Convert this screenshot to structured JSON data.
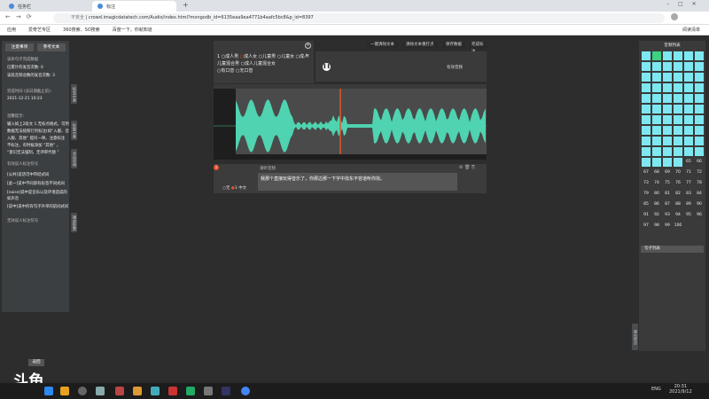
{
  "browser": {
    "tabs": [
      {
        "label": "任务栏"
      },
      {
        "label": "标注"
      }
    ],
    "url_prefix": "不安全",
    "url": "crowd.imagicdatatech.com/Audio/index.html?mongodb_id=6135eaa9ea4771b4aafc5bc8&p_id=8397",
    "bookmarks": [
      "应用",
      "爱奇艺专区",
      "360搜索、SO搜索",
      "百度一下，你就知道"
    ],
    "reading_list": "阅读清单"
  },
  "left": {
    "btn_rules": "注意事项",
    "btn_ref": "参考文本",
    "title": "该条句子完成数据",
    "stat1": "已累计的发音次数: 0",
    "stat2": "该段音频总数的发音次数: 3",
    "deadline_label": "完成时间 (该日期截止前):",
    "deadline": "2021-12-21 10:23",
    "tips_label": "温馨提示:",
    "tip1": "输入如上2段文 1.无标点格式，可用",
    "tip2": "数据无法按照行列标注(如“入服、音",
    "tip3": "入服、其他” 提问一律。注意标注",
    "tip4": "不标注，有时候添加 “其他” ，",
    "tip5": "“意识无法强制，无评审代替 ”",
    "rule_title": "有效说人标注符号",
    "rule1": "[公共]说话可中带结式间",
    "rule2": "[此一]说中不同部有标签不同式间",
    "rule3": "[noise]说中是音乐以及环境造成的",
    "rule3b": "如声音",
    "rule4": "[说中]说中的有句子外单的前间式间",
    "invalid": "无效说人标注符号",
    "vtabs": [
      "标签示意",
      "标题示意",
      "全局说明",
      "播放配置"
    ],
    "bottom_btn": "返回"
  },
  "options": {
    "row": "1",
    "items": [
      "成人男",
      "成人女",
      "儿童男",
      "儿童女",
      "成人儿童混合男",
      "成人儿童混合女",
      "有口音",
      "无口音"
    ]
  },
  "toolbar": {
    "b1": "一键清除文本",
    "b2": "清除文本重打点",
    "b3": "保存数据",
    "b4": "完成标注"
  },
  "player": {
    "label": "有效音频"
  },
  "transcript": {
    "header": "请听音频",
    "text": "我那个直接玩得音乐了，你那边那一下字中找东不容道听你找。",
    "marker": "1",
    "opt1": "无",
    "opt2": "1",
    "opt3": "中文"
  },
  "right": {
    "title": "音频列表",
    "numbers": [
      "65",
      "66",
      "67",
      "68",
      "69",
      "70",
      "71",
      "72",
      "73",
      "74",
      "75",
      "76",
      "77",
      "78",
      "79",
      "80",
      "81",
      "82",
      "83",
      "84",
      "85",
      "86",
      "87",
      "88",
      "89",
      "90",
      "91",
      "92",
      "93",
      "94",
      "95",
      "96",
      "97",
      "98",
      "99",
      "100"
    ],
    "sub": "句子列表",
    "vtab": "操作提示"
  },
  "taskbar": {
    "time": "20:31",
    "date": "2021/9/12",
    "lang": "ENG"
  },
  "colors": {
    "cyan": "#7ee8f2",
    "wave": "#4fd3b0",
    "orange": "#e8522a",
    "green": "#3fd081"
  }
}
